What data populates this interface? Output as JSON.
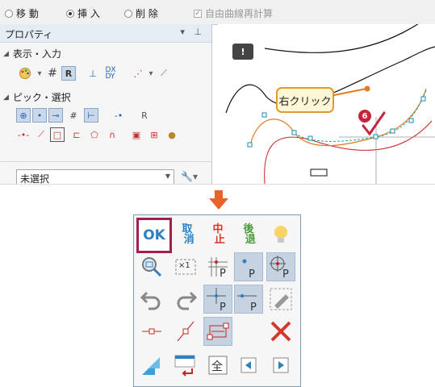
{
  "mode_bar": {
    "options": [
      {
        "label": "移 動",
        "selected": false
      },
      {
        "label": "挿 入",
        "selected": true
      },
      {
        "label": "削 除",
        "selected": false
      }
    ],
    "checkbox": {
      "label": "自由曲線再計算",
      "checked": true,
      "disabled": true
    }
  },
  "properties": {
    "title": "プロパティ",
    "section_display": "表示・入力",
    "section_pick": "ピック・選択",
    "select_value": "未選択"
  },
  "canvas": {
    "callout": "右クリック",
    "step_number": "6"
  },
  "popup": {
    "ok_label": "OK",
    "cancel_label": "取\n 消",
    "abort_label": "中\n 止",
    "back_label": "後\n 退",
    "zoom_ratio_label": "×1",
    "all_label": "全"
  },
  "colors": {
    "ok_border": "#a31f4a",
    "ok_text": "#2e80c0",
    "abort_text": "#d33a2c",
    "back_text": "#4a9a3a",
    "callout_border": "#e39b2f",
    "callout_bg": "#fdf7d6",
    "arrow": "#e8622a",
    "step_badge": "#c5243c",
    "active_cell": "#c5d2e2"
  }
}
